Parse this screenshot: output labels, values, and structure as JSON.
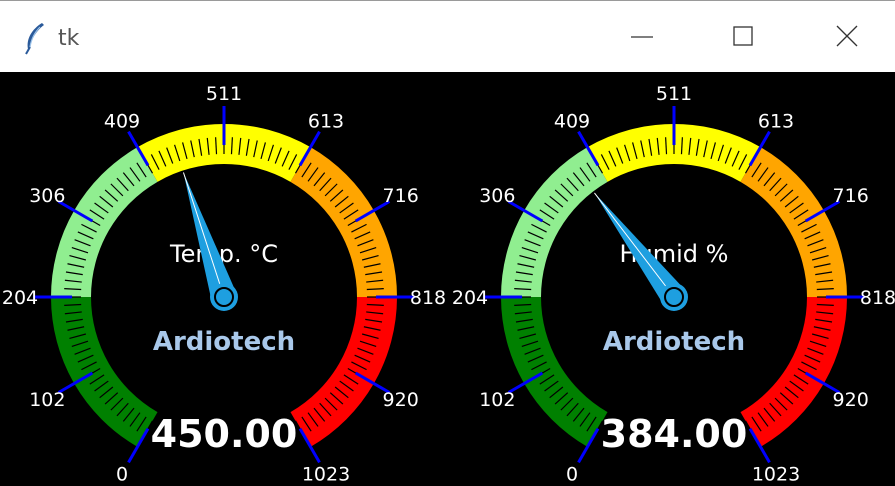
{
  "window": {
    "title": "tk",
    "app_icon": "feather-icon",
    "minimize_icon": "minimize-icon",
    "maximize_icon": "maximize-icon",
    "close_icon": "close-icon"
  },
  "gauges": [
    {
      "id": "temperature",
      "label": "Temp. °C",
      "brand": "Ardiotech",
      "value": 450.0,
      "value_text": "450.00",
      "min": 0,
      "max": 1023,
      "ticks": [
        "0",
        "102",
        "204",
        "306",
        "409",
        "511",
        "613",
        "716",
        "818",
        "920",
        "1023"
      ]
    },
    {
      "id": "humidity",
      "label": "Humid %",
      "brand": "Ardiotech",
      "value": 384.0,
      "value_text": "384.00",
      "min": 0,
      "max": 1023,
      "ticks": [
        "0",
        "102",
        "204",
        "306",
        "409",
        "511",
        "613",
        "716",
        "818",
        "920",
        "1023"
      ]
    }
  ],
  "colors": {
    "background": "#000000",
    "zone_green": "#008000",
    "zone_lightgreen": "#90ee90",
    "zone_yellow": "#ffff00",
    "zone_orange": "#ffa500",
    "zone_red": "#ff0000",
    "needle": "#1e9fe0",
    "tick_major": "#0000ff",
    "label_text": "#ffffff",
    "brand_text": "#a9c8ea"
  }
}
